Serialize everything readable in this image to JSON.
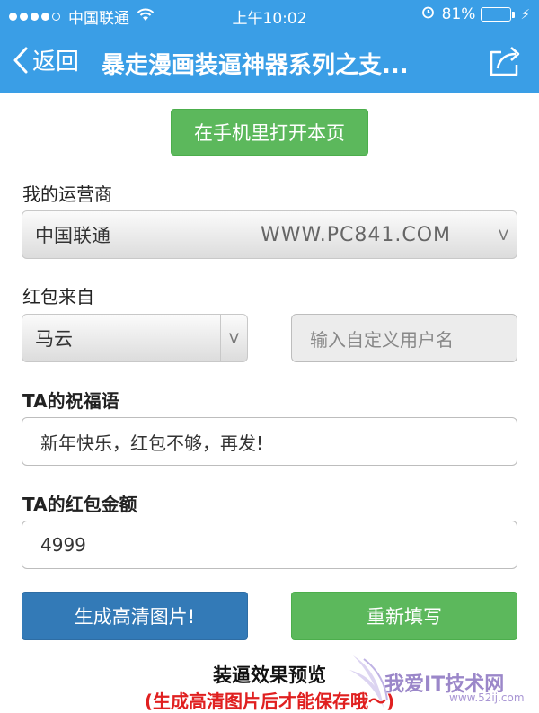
{
  "status_bar": {
    "carrier": "中国联通",
    "time": "上午10:02",
    "battery": "81%",
    "battery_level": 0.81
  },
  "navbar": {
    "back_label": "返回",
    "title": "暴走漫画装逼神器系列之支..."
  },
  "open_in_phone_button": "在手机里打开本页",
  "carrier_section": {
    "label": "我的运营商",
    "selected": "中国联通",
    "watermark": "WWW.PC841.COM"
  },
  "sender_section": {
    "label": "红包来自",
    "selected": "马云",
    "custom_placeholder": "输入自定义用户名"
  },
  "greeting_section": {
    "label": "TA的祝福语",
    "value": "新年快乐，红包不够，再发!"
  },
  "amount_section": {
    "label": "TA的红包金额",
    "value": "4999"
  },
  "buttons": {
    "generate": "生成高清图片!",
    "reset": "重新填写"
  },
  "preview": {
    "title": "装逼效果预览",
    "note": "(生成高清图片后才能保存哦～)"
  },
  "logo": {
    "text": "我爱IT技术网",
    "url": "www.52ij.com"
  },
  "colors": {
    "header_blue": "#3a9ee6",
    "green": "#5cb85c",
    "blue": "#337ab7",
    "red_note": "#e02020"
  }
}
